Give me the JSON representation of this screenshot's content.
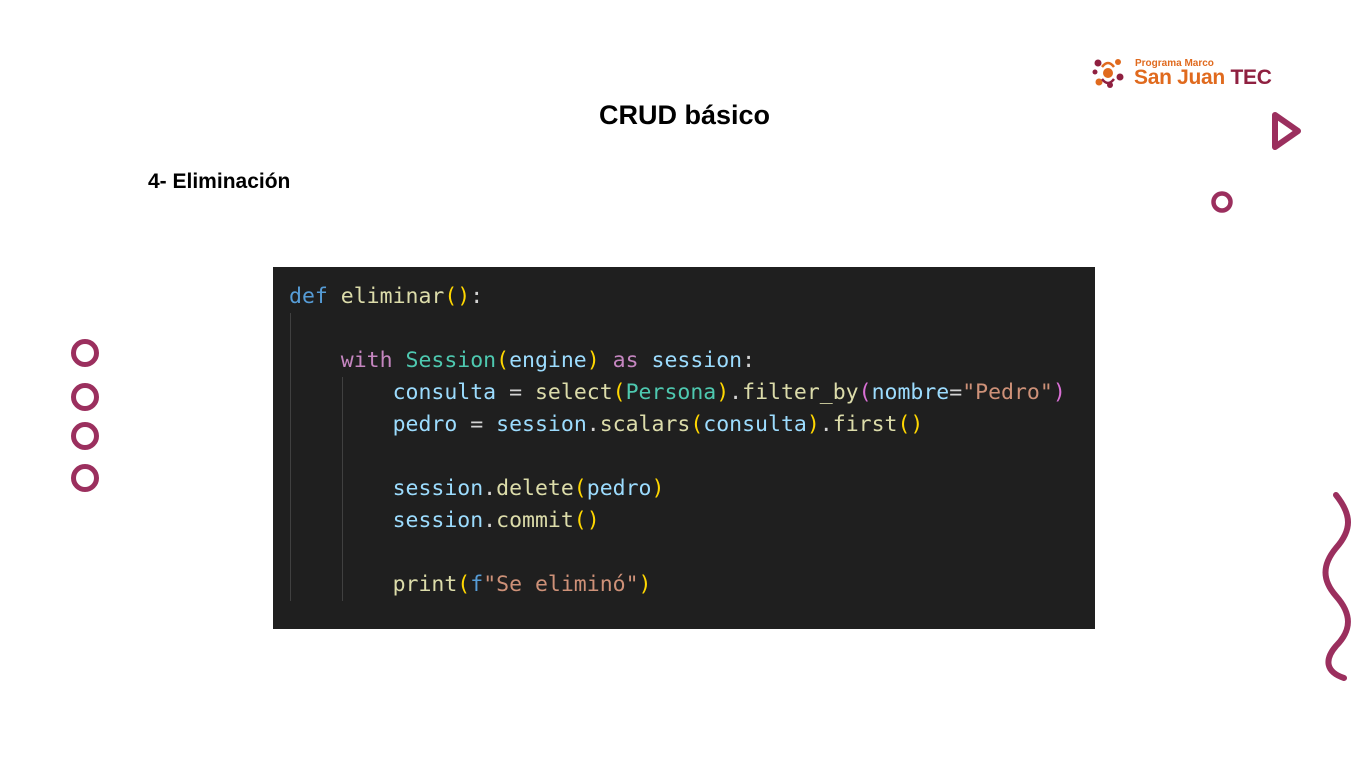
{
  "slide": {
    "title": "CRUD básico",
    "subtitle": "4- Eliminación"
  },
  "logo": {
    "small_text": "Programa Marco",
    "brand_a": "San Juan",
    "brand_b": "TEC",
    "colors": {
      "orange": "#e06a1e",
      "maroon": "#8f2040"
    }
  },
  "decoration": {
    "accent_color": "#9b2f5e"
  },
  "code": {
    "tokens": {
      "def": "def",
      "func_name": "eliminar",
      "with": "with",
      "Session": "Session",
      "engine": "engine",
      "as": "as",
      "session": "session",
      "consulta": "consulta",
      "eq": "=",
      "select": "select",
      "Persona": "Persona",
      "filter_by": "filter_by",
      "nombre": "nombre",
      "pedro_str": "\"Pedro\"",
      "pedro": "pedro",
      "scalars": "scalars",
      "first": "first",
      "delete": "delete",
      "commit": "commit",
      "print": "print",
      "fstr_prefix": "f",
      "fstr_body": "\"Se eliminó\""
    }
  }
}
